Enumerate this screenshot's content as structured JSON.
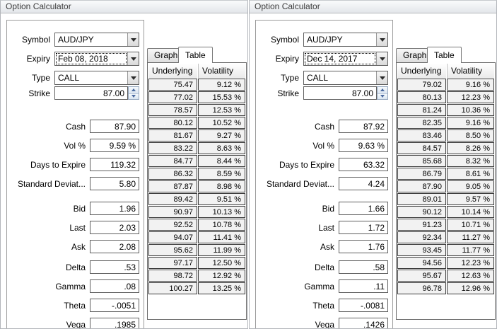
{
  "window": {
    "title": "Option Calculator"
  },
  "labels": {
    "symbol": "Symbol",
    "expiry": "Expiry",
    "type": "Type",
    "strike": "Strike",
    "cash": "Cash",
    "vol": "Vol %",
    "days_to_expire": "Days to Expire",
    "standard_deviation": "Standard Deviat...",
    "bid": "Bid",
    "last": "Last",
    "ask": "Ask",
    "delta": "Delta",
    "gamma": "Gamma",
    "theta": "Theta",
    "vega": "Vega"
  },
  "tabs": {
    "graph": "Graph",
    "table": "Table",
    "active_tab": "Table"
  },
  "table_headers": {
    "underlying": "Underlying",
    "volatility": "Volatility"
  },
  "icons": {
    "dropdown_arrow": "chevron-down",
    "spin_up": "triangle-up",
    "spin_down": "triangle-down"
  },
  "colors": {
    "titlebar_text": "#3c3c3c",
    "spinner_arrow": "#4a6aa0",
    "table_cell_bg": "#f2f2f2",
    "input_border": "#5f5f5f"
  },
  "panels": [
    {
      "symbol": "AUD/JPY",
      "expiry": "Feb 08, 2018",
      "type": "CALL",
      "strike": "87.00",
      "cash": "87.90",
      "vol": "9.59 %",
      "days_to_expire": "119.32",
      "standard_deviation": "5.80",
      "bid": "1.96",
      "last": "2.03",
      "ask": "2.08",
      "delta": ".53",
      "gamma": ".08",
      "theta": "-.0051",
      "vega": ".1985",
      "table_rows": [
        [
          "75.47",
          "9.12 %"
        ],
        [
          "77.02",
          "15.53 %"
        ],
        [
          "78.57",
          "12.53 %"
        ],
        [
          "80.12",
          "10.52 %"
        ],
        [
          "81.67",
          "9.27 %"
        ],
        [
          "83.22",
          "8.63 %"
        ],
        [
          "84.77",
          "8.44 %"
        ],
        [
          "86.32",
          "8.59 %"
        ],
        [
          "87.87",
          "8.98 %"
        ],
        [
          "89.42",
          "9.51 %"
        ],
        [
          "90.97",
          "10.13 %"
        ],
        [
          "92.52",
          "10.78 %"
        ],
        [
          "94.07",
          "11.41 %"
        ],
        [
          "95.62",
          "11.99 %"
        ],
        [
          "97.17",
          "12.50 %"
        ],
        [
          "98.72",
          "12.92 %"
        ],
        [
          "100.27",
          "13.25 %"
        ]
      ]
    },
    {
      "symbol": "AUD/JPY",
      "expiry": "Dec 14, 2017",
      "type": "CALL",
      "strike": "87.00",
      "cash": "87.92",
      "vol": "9.63 %",
      "days_to_expire": "63.32",
      "standard_deviation": "4.24",
      "bid": "1.66",
      "last": "1.72",
      "ask": "1.76",
      "delta": ".58",
      "gamma": ".11",
      "theta": "-.0081",
      "vega": ".1426",
      "table_rows": [
        [
          "79.02",
          "9.16 %"
        ],
        [
          "80.13",
          "12.23 %"
        ],
        [
          "81.24",
          "10.36 %"
        ],
        [
          "82.35",
          "9.16 %"
        ],
        [
          "83.46",
          "8.50 %"
        ],
        [
          "84.57",
          "8.26 %"
        ],
        [
          "85.68",
          "8.32 %"
        ],
        [
          "86.79",
          "8.61 %"
        ],
        [
          "87.90",
          "9.05 %"
        ],
        [
          "89.01",
          "9.57 %"
        ],
        [
          "90.12",
          "10.14 %"
        ],
        [
          "91.23",
          "10.71 %"
        ],
        [
          "92.34",
          "11.27 %"
        ],
        [
          "93.45",
          "11.77 %"
        ],
        [
          "94.56",
          "12.23 %"
        ],
        [
          "95.67",
          "12.63 %"
        ],
        [
          "96.78",
          "12.96 %"
        ]
      ]
    }
  ]
}
